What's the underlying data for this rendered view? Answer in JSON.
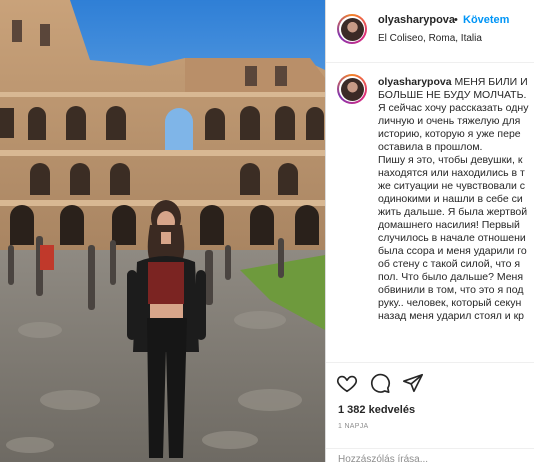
{
  "post": {
    "username": "olyasharypova",
    "separator": "•",
    "follow_label": "Követem",
    "location": "El Coliseo, Roma, Italia",
    "caption_lines": [
      "МЕНЯ БИЛИ И",
      "БОЛЬШЕ НЕ БУДУ МОЛЧАТЬ.",
      "Я сейчас хочу рассказать одну",
      "личную и очень тяжелую для",
      "историю, которую я уже пере",
      "оставила в прошлом.",
      "Пишу я это, чтобы девушки, к",
      "находятся или находились в т",
      "же ситуации не чувствовали с",
      "одинокими и нашли в себе си",
      "жить дальше. Я была жертвой",
      "домашнего насилия! Первый",
      "случилось в начале отношени",
      "была ссора и меня ударили го",
      "об стену с такой силой, что я",
      "пол. Что было дальше? Меня",
      "обвинили в том, что это я под",
      "руку.. человек, который секун",
      "назад меня ударил стоял и кр"
    ],
    "likes": "1 382 kedvelés",
    "posted_ago": "1 NAPJA",
    "comment_placeholder": "Hozzászólás írása..."
  },
  "icons": {
    "like": "heart-icon",
    "comment": "comment-icon",
    "share": "share-icon"
  },
  "colors": {
    "link_blue": "#0095f6",
    "text": "#262626",
    "muted": "#8e8e8e",
    "border": "#dbdbdb"
  }
}
